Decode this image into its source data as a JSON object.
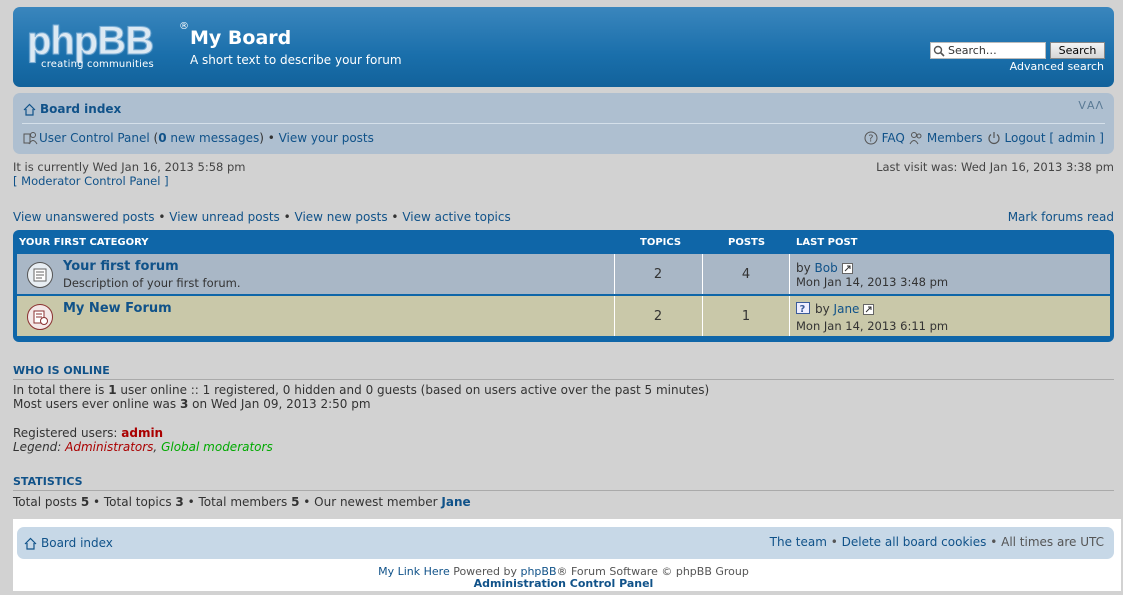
{
  "header": {
    "logo_word": "phpBB",
    "logo_reg": "®",
    "logo_tag": "creating   communities",
    "title": "My Board",
    "description": "A short text to describe your forum",
    "search_placeholder": "Search…",
    "search_button": "Search",
    "advanced_search": "Advanced search"
  },
  "nav": {
    "board_index": "Board index",
    "font_size": "ᐯAᐱ",
    "ucp_label": "User Control Panel",
    "ucp_open": " (",
    "new_messages_count": "0",
    "new_messages_label": " new messages",
    "ucp_close": ") • ",
    "view_posts": "View your posts",
    "faq": "FAQ",
    "members": "Members",
    "logout": "Logout [ admin ]"
  },
  "info": {
    "current_time": "It is currently Wed Jan 16, 2013 5:58 pm",
    "mcp": "[ Moderator Control Panel ]",
    "last_visit": "Last visit was: Wed Jan 16, 2013 3:38 pm"
  },
  "search_links": {
    "unanswered": "View unanswered posts",
    "unread": "View unread posts",
    "new": "View new posts",
    "active": "View active topics",
    "sep": " • ",
    "mark_read": "Mark forums read"
  },
  "forum_table": {
    "category": "YOUR FIRST CATEGORY",
    "col_topics": "TOPICS",
    "col_posts": "POSTS",
    "col_last": "LAST POST",
    "forums": [
      {
        "title": "Your first forum",
        "description": "Description of your first forum.",
        "topics": "2",
        "posts": "4",
        "last_by": "by ",
        "last_user": "Bob",
        "last_date": "Mon Jan 14, 2013 3:48 pm"
      },
      {
        "title": "My New Forum",
        "description": "",
        "topics": "2",
        "posts": "1",
        "last_by": "by ",
        "last_user": "Jane",
        "last_date": "Mon Jan 14, 2013 6:11 pm"
      }
    ]
  },
  "online": {
    "title": "WHO IS ONLINE",
    "line1_a": "In total there is ",
    "line1_count": "1",
    "line1_b": " user online :: 1 registered, 0 hidden and 0 guests (based on users active over the past 5 minutes)",
    "line2_a": "Most users ever online was ",
    "line2_count": "3",
    "line2_b": " on Wed Jan 09, 2013 2:50 pm",
    "registered_label": "Registered users: ",
    "registered_user": "admin",
    "legend_label": "Legend: ",
    "legend_admins": "Administrators",
    "legend_sep": ", ",
    "legend_gmods": "Global moderators"
  },
  "stats": {
    "title": "STATISTICS",
    "posts_label": "Total posts ",
    "posts": "5",
    "topics_label": " • Total topics ",
    "topics": "3",
    "members_label": " • Total members ",
    "members": "5",
    "newest_label": " • Our newest member ",
    "newest": "Jane"
  },
  "footer": {
    "board_index": "Board index",
    "team": "The team",
    "sep": " • ",
    "delete_cookies": "Delete all board cookies",
    "times": "All times are UTC",
    "my_link": "My Link Here",
    "powered_a": " Powered by ",
    "phpbb": "phpBB",
    "powered_b": "® Forum Software © phpBB Group",
    "acp": "Administration Control Panel"
  }
}
